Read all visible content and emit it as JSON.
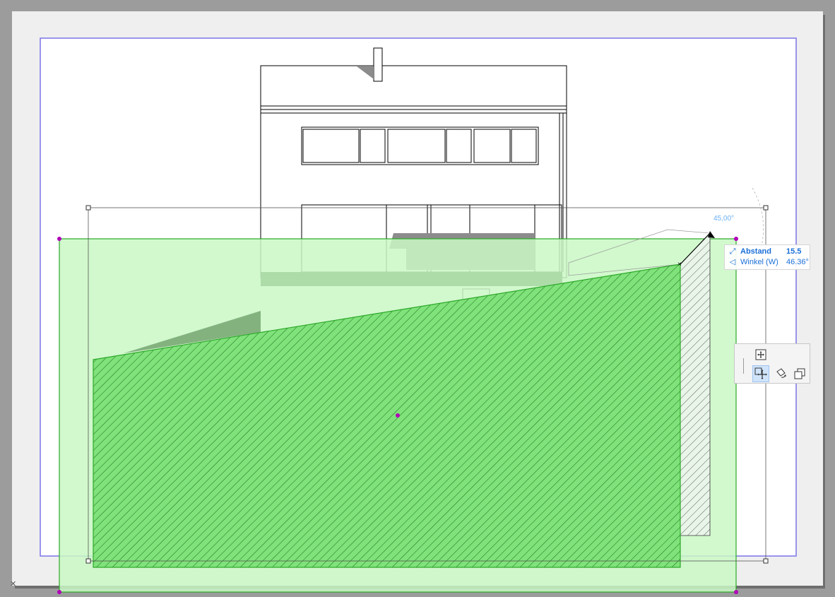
{
  "viewport": {
    "background_color": "#9c9c9c",
    "sheet_color": "#efefef",
    "paper_color": "#ffffff",
    "frame_color": "#7b74e8"
  },
  "colors": {
    "fill_light": "#c9f8c4",
    "fill_mid": "#7fe27a",
    "fill_stroke": "#2da82a",
    "hatch_dark": "#1a6e1a",
    "balcony_dark": "#0f3d10",
    "hotspot": "#b000b8",
    "accent": "#1a6fd8"
  },
  "tracker": {
    "angle_guide": "45,00°",
    "rows": [
      {
        "icon": "distance-icon",
        "glyph": "⤢",
        "label": "Abstand",
        "value": "15.5",
        "emphasis": true
      },
      {
        "icon": "angle-icon",
        "glyph": "◁",
        "label": "Winkel (W)",
        "value": "46.36°",
        "emphasis": false
      }
    ]
  },
  "pet_palette": {
    "buttons": [
      {
        "name": "offset-all-icon",
        "active": false
      },
      {
        "name": "drag-move-icon",
        "active": true
      },
      {
        "name": "rotate-icon",
        "active": false
      },
      {
        "name": "multiply-copy-icon",
        "active": false
      }
    ]
  },
  "corner_glyph": "✕"
}
